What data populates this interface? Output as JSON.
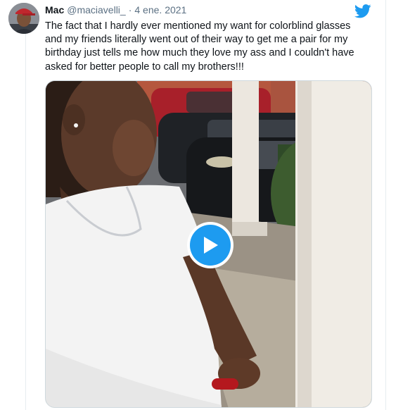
{
  "tweet": {
    "author_name": "Mac",
    "author_handle": "@maciavelli_",
    "separator": "·",
    "date": "4 ene. 2021",
    "text": "The fact that I hardly ever mentioned my want for colorblind glasses\nand my friends literally went out of their way to get me a pair for my\nbirthday just tells me how much they love my ass and I couldn't have\nasked for better people to call my brothers!!!"
  },
  "icons": {
    "platform": "twitter-bird-icon",
    "media_control": "play-icon"
  },
  "colors": {
    "brand_blue": "#1d9bf0",
    "handle_gray": "#5b7083"
  }
}
